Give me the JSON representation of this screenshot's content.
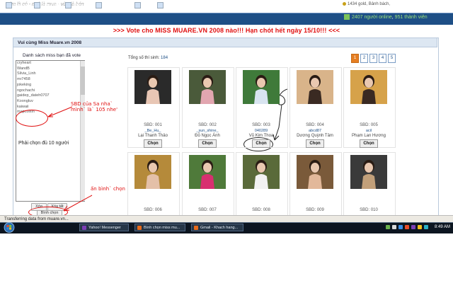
{
  "header": {
    "slogan": "Tìm là có - ngó là mua - vừa là bán",
    "user_points": "1434 gold, Bảnh bách,"
  },
  "nav": [
    {
      "label": "Hue vé",
      "icon": "ticket-icon"
    },
    {
      "label": "Tìm kiếm",
      "icon": "search-icon"
    },
    {
      "label": "Diễn đàn",
      "icon": "forum-icon"
    },
    {
      "label": "Trang cá nhân",
      "icon": "profile-icon"
    },
    {
      "label": "Chat",
      "icon": "chat-icon"
    },
    {
      "label": "Giúp đỡ",
      "icon": "help-icon"
    }
  ],
  "online": {
    "count_text": "2407 người online",
    "sep": ",",
    "members": "951 thành viên"
  },
  "banner": ">>> Vote cho MISS MUARE.VN 2008 nào!!! Hạn chót hết ngày 15/10!!! <<<",
  "panel": {
    "title": "Vui cùng Miss Muare.vn 2008",
    "list_title": "Danh sách miss bạn đã vote",
    "voted": [
      "cryheart",
      "WandB",
      "Silvia_Linh",
      "mr7458",
      "jokeking",
      "ngochachi",
      "gaidep_dateh0707",
      "Koongluv",
      "kaiwaii",
      "mapcoixin"
    ],
    "required_note": "Phải chọn đủ 10 người",
    "delete_label": "Xóa",
    "delete_all_label": "Xóa tất",
    "vote_label": "Bình chọn"
  },
  "annotations": {
    "sbd_note": "SBD của Sa nha` mình` là` 105 nhe'",
    "press_note": "ấn bình` chọn"
  },
  "total": {
    "label": "Tổng số thí sinh:",
    "value": "184"
  },
  "pages": [
    "1",
    "2",
    "3",
    "4",
    "5"
  ],
  "contestants": [
    {
      "sbd": "SBD: 001",
      "user": "_Be_Hu_",
      "name": "Lại Thanh Thảo",
      "btn": "Chọn",
      "photo": "#2a2a2a",
      "skin": "#e8c6b4"
    },
    {
      "sbd": "SBD: 002",
      "user": "_sun_shine_",
      "name": "Đỗ Ngọc Ánh",
      "btn": "Chọn",
      "photo": "#4a5a3a",
      "skin": "#e2a6b0"
    },
    {
      "sbd": "SBD: 003",
      "user": "040289",
      "name": "Vũ Kim Thoa",
      "btn": "Chọn",
      "photo": "#3f7a3a",
      "skin": "#d8e4f0"
    },
    {
      "sbd": "SBD: 004",
      "user": "abcd87",
      "name": "Dương Quỳnh Tâm",
      "btn": "Chọn",
      "photo": "#d9b48a",
      "skin": "#3a2a22"
    },
    {
      "sbd": "SBD: 005",
      "user": "acil",
      "name": "Phạm Lan Hương",
      "btn": "Chọn",
      "photo": "#d6a24a",
      "skin": "#3a2a22"
    },
    {
      "sbd": "SBD: 006",
      "user": "",
      "name": "",
      "btn": "",
      "photo": "#b58a3a",
      "skin": "#e4c0a8"
    },
    {
      "sbd": "SBD: 007",
      "user": "",
      "name": "",
      "btn": "",
      "photo": "#4f7a3a",
      "skin": "#d83070"
    },
    {
      "sbd": "SBD: 008",
      "user": "",
      "name": "",
      "btn": "",
      "photo": "#5a6a3a",
      "skin": "#f2f2f2"
    },
    {
      "sbd": "SBD: 009",
      "user": "",
      "name": "",
      "btn": "",
      "photo": "#7a5a3a",
      "skin": "#e2b89a"
    },
    {
      "sbd": "SBD: 010",
      "user": "",
      "name": "",
      "btn": "",
      "photo": "#3a3a3a",
      "skin": "#c2a07a"
    }
  ],
  "status": {
    "text": "Transferring data from muare.vn..."
  },
  "taskbar": {
    "tasks": [
      {
        "label": "Yahoo! Messenger",
        "color": "#7b3fb5"
      },
      {
        "label": "Bình chọn miss mu...",
        "color": "#e86a1a"
      },
      {
        "label": "Gmail - Khach hang...",
        "color": "#e86a1a"
      }
    ],
    "clock": "8:49 AM"
  },
  "colors": {
    "accent": "#1e4f86",
    "banner": "#e01010",
    "active_page": "#e67e22"
  }
}
